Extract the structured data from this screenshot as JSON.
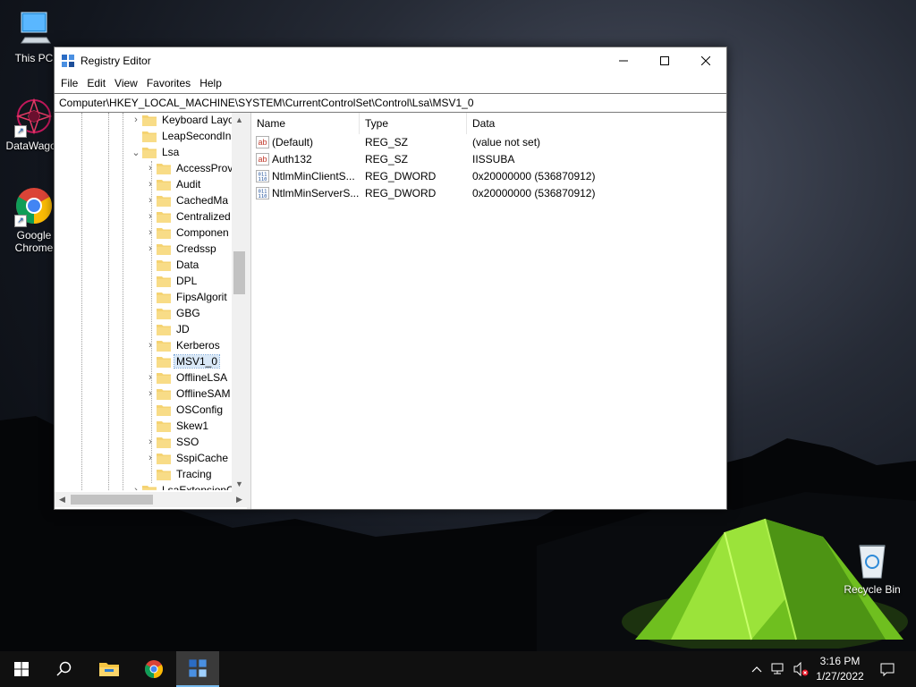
{
  "desktop": {
    "icons": [
      {
        "label": "This PC",
        "icon": "computer-icon"
      },
      {
        "label": "DataWagon",
        "icon": "datawagon-icon"
      },
      {
        "label": "Google Chrome",
        "icon": "chrome-icon"
      },
      {
        "label": "Recycle Bin",
        "icon": "recycle-bin-icon"
      }
    ]
  },
  "window": {
    "title": "Registry Editor",
    "menu": [
      "File",
      "Edit",
      "View",
      "Favorites",
      "Help"
    ],
    "address": "Computer\\HKEY_LOCAL_MACHINE\\SYSTEM\\CurrentControlSet\\Control\\Lsa\\MSV1_0"
  },
  "tree": {
    "items": [
      {
        "label": "Keyboard Layo",
        "expander": "›"
      },
      {
        "label": "LeapSecondIn",
        "expander": ""
      },
      {
        "label": "Lsa",
        "expander": "⌄"
      },
      {
        "label": "AccessProv",
        "expander": "›"
      },
      {
        "label": "Audit",
        "expander": "›"
      },
      {
        "label": "CachedMa",
        "expander": "›"
      },
      {
        "label": "Centralized",
        "expander": "›"
      },
      {
        "label": "Componen",
        "expander": "›"
      },
      {
        "label": "Credssp",
        "expander": "›"
      },
      {
        "label": "Data",
        "expander": ""
      },
      {
        "label": "DPL",
        "expander": ""
      },
      {
        "label": "FipsAlgorit",
        "expander": ""
      },
      {
        "label": "GBG",
        "expander": ""
      },
      {
        "label": "JD",
        "expander": ""
      },
      {
        "label": "Kerberos",
        "expander": "›"
      },
      {
        "label": "MSV1_0",
        "expander": ""
      },
      {
        "label": "OfflineLSA",
        "expander": "›"
      },
      {
        "label": "OfflineSAM",
        "expander": "›"
      },
      {
        "label": "OSConfig",
        "expander": ""
      },
      {
        "label": "Skew1",
        "expander": ""
      },
      {
        "label": "SSO",
        "expander": "›"
      },
      {
        "label": "SspiCache",
        "expander": "›"
      },
      {
        "label": "Tracing",
        "expander": ""
      },
      {
        "label": "LsaExtensionC",
        "expander": "›"
      }
    ]
  },
  "list": {
    "columns": [
      "Name",
      "Type",
      "Data"
    ],
    "rows": [
      {
        "name": "(Default)",
        "type": "REG_SZ",
        "data": "(value not set)",
        "icon": "ab"
      },
      {
        "name": "Auth132",
        "type": "REG_SZ",
        "data": "IISSUBA",
        "icon": "ab"
      },
      {
        "name": "NtlmMinClientS...",
        "type": "REG_DWORD",
        "data": "0x20000000 (536870912)",
        "icon": "bin"
      },
      {
        "name": "NtlmMinServerS...",
        "type": "REG_DWORD",
        "data": "0x20000000 (536870912)",
        "icon": "bin"
      }
    ]
  },
  "taskbar": {
    "time": "3:16 PM",
    "date": "1/27/2022"
  },
  "colors": {
    "selection": "#d9e8f7",
    "folder": "#f5d372",
    "accent": "#76b9ed"
  }
}
